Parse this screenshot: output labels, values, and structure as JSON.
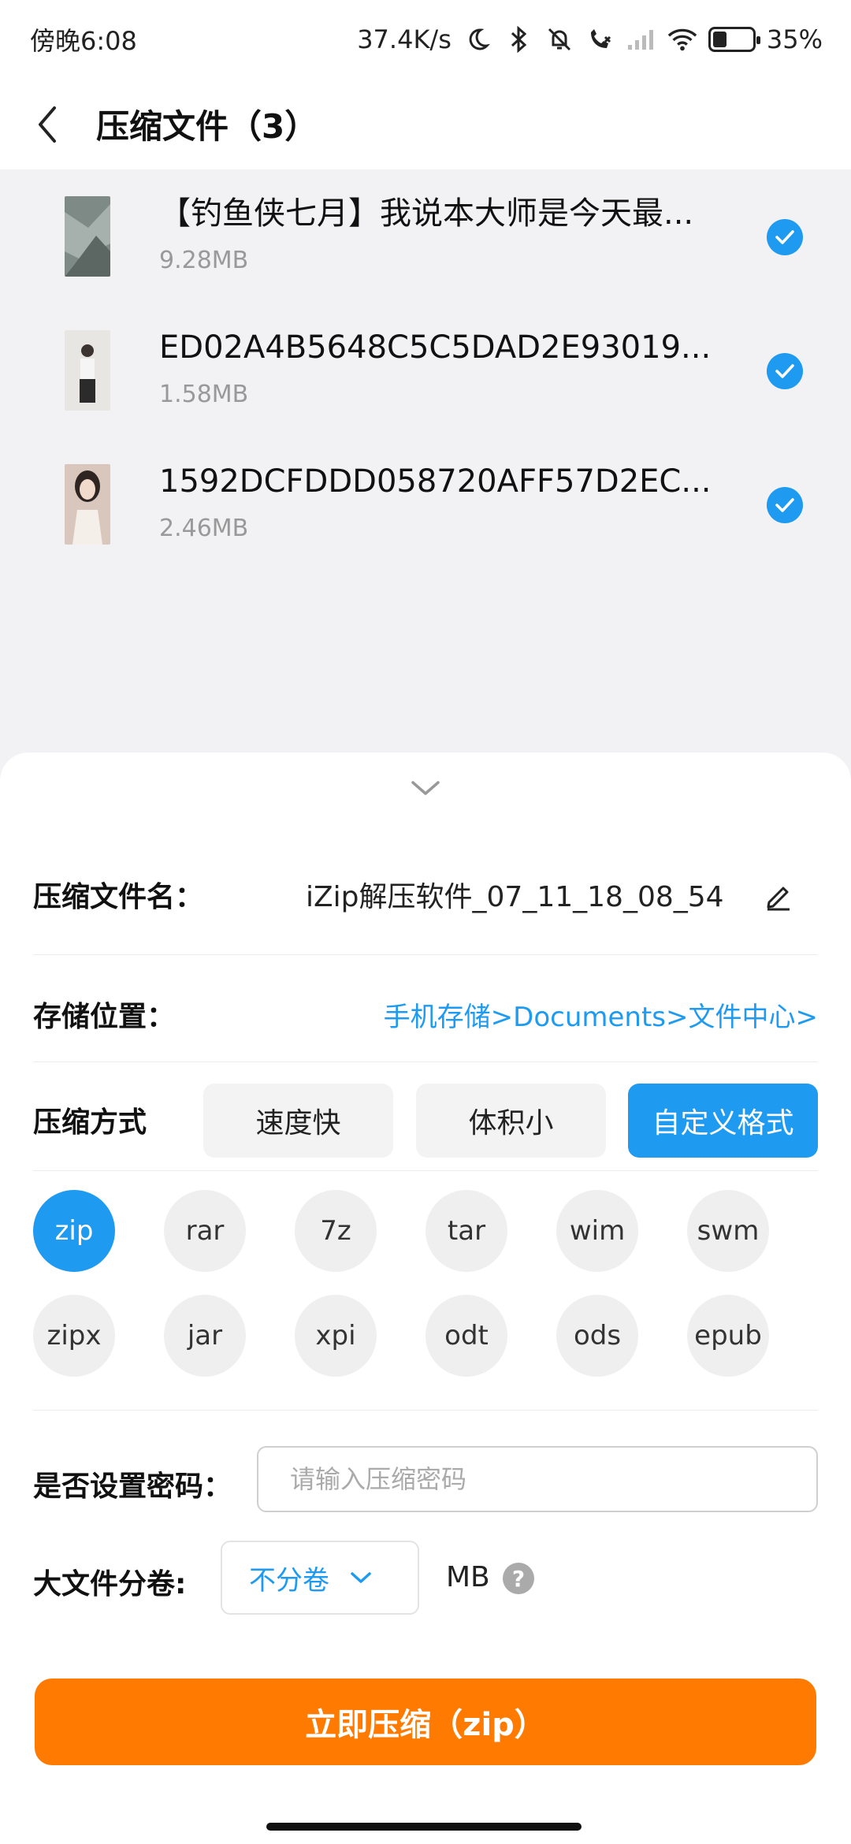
{
  "status_bar": {
    "time": "傍晚6:08",
    "network_speed": "37.4K/s",
    "battery_percent": "35%",
    "battery_level": 0.35,
    "icons": [
      "moon-icon",
      "bluetooth-icon",
      "mute-bell-icon",
      "call-forward-icon",
      "signal-icon",
      "wifi-icon",
      "battery-icon"
    ]
  },
  "header": {
    "title": "压缩文件（3）",
    "back_icon": "chevron-left-icon"
  },
  "files": [
    {
      "name": "【钓鱼侠七月】我说本大师是今天最...",
      "size": "9.28MB",
      "selected": true
    },
    {
      "name": "ED02A4B5648C5C5DAD2E93019...",
      "size": "1.58MB",
      "selected": true
    },
    {
      "name": "1592DCFDDD058720AFF57D2EC...",
      "size": "2.46MB",
      "selected": true
    }
  ],
  "sheet": {
    "filename_label": "压缩文件名：",
    "filename_value": "iZip解压软件_07_11_18_08_54",
    "location_label": "存储位置：",
    "location_value": "手机存储>Documents>文件中心>",
    "mode_label": "压缩方式",
    "modes": [
      "速度快",
      "体积小",
      "自定义格式"
    ],
    "active_mode": "自定义格式",
    "formats": [
      "zip",
      "rar",
      "7z",
      "tar",
      "wim",
      "swm",
      "zipx",
      "jar",
      "xpi",
      "odt",
      "ods",
      "epub"
    ],
    "active_format": "zip",
    "password_label": "是否设置密码：",
    "password_placeholder": "请输入压缩密码",
    "split_label": "大文件分卷:",
    "split_value": "不分卷",
    "split_unit": "MB",
    "help_glyph": "?",
    "compress_button": "立即压缩（zip）"
  },
  "colors": {
    "accent_blue": "#1e9bf0",
    "action_orange": "#ff7a00",
    "background": "#f2f2f4"
  }
}
